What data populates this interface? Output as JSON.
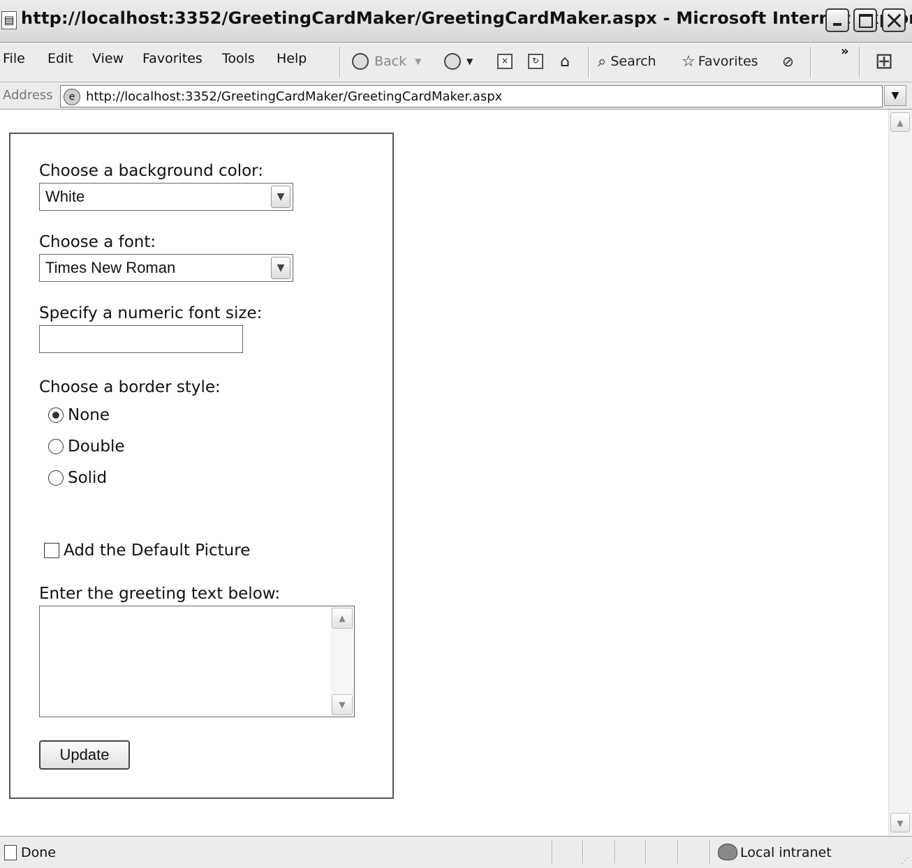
{
  "window": {
    "title": "http://localhost:3352/GreetingCardMaker/GreetingCardMaker.aspx - Microsoft Internet Explorer"
  },
  "menu": {
    "items": [
      {
        "label": "File"
      },
      {
        "label": "Edit"
      },
      {
        "label": "View"
      },
      {
        "label": "Favorites"
      },
      {
        "label": "Tools"
      },
      {
        "label": "Help"
      }
    ]
  },
  "toolbar": {
    "back_label": "Back",
    "search_label": "Search",
    "favorites_label": "Favorites",
    "chevron": "»"
  },
  "address": {
    "label": "Address",
    "url": "http://localhost:3352/GreetingCardMaker/GreetingCardMaker.aspx"
  },
  "form": {
    "bgcolor_label": "Choose a background color:",
    "bgcolor_value": "White",
    "font_label": "Choose a font:",
    "font_value": "Times New Roman",
    "fontsize_label": "Specify a numeric font size:",
    "fontsize_value": "",
    "border_label": "Choose a border style:",
    "border_options": [
      {
        "label": "None",
        "selected": true
      },
      {
        "label": "Double",
        "selected": false
      },
      {
        "label": "Solid",
        "selected": false
      }
    ],
    "picture_label": "Add the Default Picture",
    "picture_checked": false,
    "greeting_label": "Enter the greeting text below:",
    "greeting_value": "",
    "update_button": "Update"
  },
  "status": {
    "text": "Done",
    "zone": "Local intranet"
  }
}
